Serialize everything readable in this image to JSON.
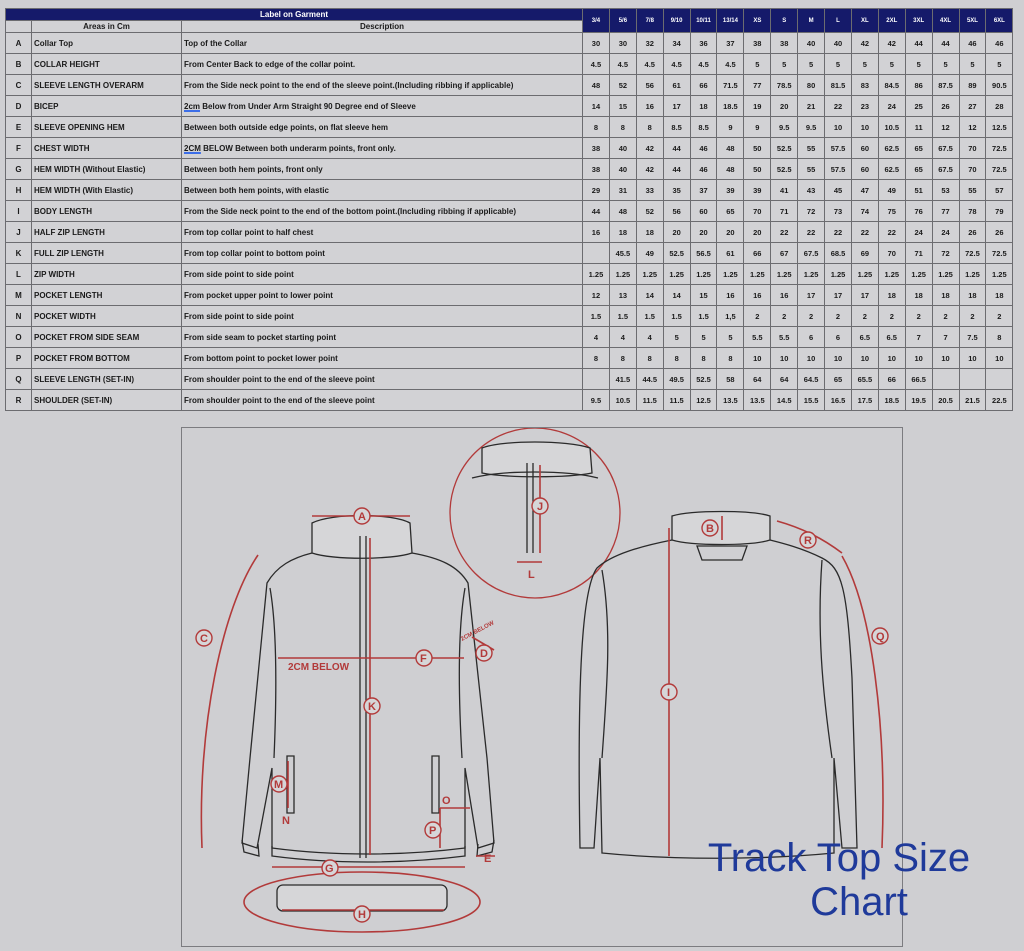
{
  "table": {
    "label_header": "Label on Garment",
    "areas_header": "Areas in Cm",
    "description_header": "Description",
    "sizes": [
      "3/4",
      "5/6",
      "7/8",
      "9/10",
      "10/11",
      "13/14",
      "XS",
      "S",
      "M",
      "L",
      "XL",
      "2XL",
      "3XL",
      "4XL",
      "5XL",
      "6XL"
    ],
    "rows": [
      {
        "letter": "A",
        "area": "Collar Top",
        "desc": "Top of the Collar",
        "values": [
          "30",
          "30",
          "32",
          "34",
          "36",
          "37",
          "38",
          "38",
          "40",
          "40",
          "42",
          "42",
          "44",
          "44",
          "46",
          "46"
        ]
      },
      {
        "letter": "B",
        "area": "COLLAR HEIGHT",
        "desc": "From Center Back to edge of the collar point.",
        "values": [
          "4.5",
          "4.5",
          "4.5",
          "4.5",
          "4.5",
          "4.5",
          "5",
          "5",
          "5",
          "5",
          "5",
          "5",
          "5",
          "5",
          "5",
          "5"
        ]
      },
      {
        "letter": "C",
        "area": "SLEEVE LENGTH OVERARM",
        "desc": "From the Side neck point to the end of the sleeve point.(Including ribbing if applicable)",
        "values": [
          "48",
          "52",
          "56",
          "61",
          "66",
          "71.5",
          "77",
          "78.5",
          "80",
          "81.5",
          "83",
          "84.5",
          "86",
          "87.5",
          "89",
          "90.5"
        ]
      },
      {
        "letter": "D",
        "area": "BICEP",
        "desc_u": "2cm",
        "desc": " Below from Under Arm Straight 90 Degree end of Sleeve",
        "values": [
          "14",
          "15",
          "16",
          "17",
          "18",
          "18.5",
          "19",
          "20",
          "21",
          "22",
          "23",
          "24",
          "25",
          "26",
          "27",
          "28"
        ]
      },
      {
        "letter": "E",
        "area": "SLEEVE OPENING HEM",
        "desc": "Between both outside edge points, on flat sleeve hem",
        "values": [
          "8",
          "8",
          "8",
          "8.5",
          "8.5",
          "9",
          "9",
          "9.5",
          "9.5",
          "10",
          "10",
          "10.5",
          "11",
          "12",
          "12",
          "12.5"
        ]
      },
      {
        "letter": "F",
        "area": "CHEST WIDTH",
        "desc_u": "2CM",
        "desc": " BELOW Between both underarm points, front only.",
        "values": [
          "38",
          "40",
          "42",
          "44",
          "46",
          "48",
          "50",
          "52.5",
          "55",
          "57.5",
          "60",
          "62.5",
          "65",
          "67.5",
          "70",
          "72.5"
        ]
      },
      {
        "letter": "G",
        "area": "HEM WIDTH (Without Elastic)",
        "desc": "Between both hem points, front only",
        "values": [
          "38",
          "40",
          "42",
          "44",
          "46",
          "48",
          "50",
          "52.5",
          "55",
          "57.5",
          "60",
          "62.5",
          "65",
          "67.5",
          "70",
          "72.5"
        ]
      },
      {
        "letter": "H",
        "area": "HEM WIDTH (With Elastic)",
        "desc": "Between both hem points, with elastic",
        "big": true,
        "values": [
          "29",
          "31",
          "33",
          "35",
          "37",
          "39",
          "39",
          "41",
          "43",
          "45",
          "47",
          "49",
          "51",
          "53",
          "55",
          "57"
        ]
      },
      {
        "letter": "I",
        "area": "BODY LENGTH",
        "desc": "From the Side neck point to the end of the bottom point.(Including ribbing if applicable)",
        "values": [
          "44",
          "48",
          "52",
          "56",
          "60",
          "65",
          "70",
          "71",
          "72",
          "73",
          "74",
          "75",
          "76",
          "77",
          "78",
          "79"
        ]
      },
      {
        "letter": "J",
        "area": "HALF ZIP LENGTH",
        "desc": "From top collar point to half chest",
        "values": [
          "16",
          "18",
          "18",
          "20",
          "20",
          "20",
          "20",
          "22",
          "22",
          "22",
          "22",
          "22",
          "24",
          "24",
          "26",
          "26"
        ]
      },
      {
        "letter": "K",
        "area": "FULL ZIP LENGTH",
        "desc": "From top collar point to bottom point",
        "values": [
          "",
          "45.5",
          "49",
          "52.5",
          "56.5",
          "61",
          "66",
          "67",
          "67.5",
          "68.5",
          "69",
          "70",
          "71",
          "72",
          "72.5",
          "72.5"
        ]
      },
      {
        "letter": "L",
        "area": "ZIP WIDTH",
        "desc": "From side point to side point",
        "values": [
          "1.25",
          "1.25",
          "1.25",
          "1.25",
          "1.25",
          "1.25",
          "1.25",
          "1.25",
          "1.25",
          "1.25",
          "1.25",
          "1.25",
          "1.25",
          "1.25",
          "1.25",
          "1.25"
        ]
      },
      {
        "letter": "M",
        "area": "POCKET LENGTH",
        "desc": "From pocket upper point to lower point",
        "values": [
          "12",
          "13",
          "14",
          "14",
          "15",
          "16",
          "16",
          "16",
          "17",
          "17",
          "17",
          "18",
          "18",
          "18",
          "18",
          "18"
        ]
      },
      {
        "letter": "N",
        "area": "POCKET WIDTH",
        "desc": "From side point to side point",
        "values": [
          "1.5",
          "1.5",
          "1.5",
          "1.5",
          "1.5",
          "1,5",
          "2",
          "2",
          "2",
          "2",
          "2",
          "2",
          "2",
          "2",
          "2",
          "2"
        ]
      },
      {
        "letter": "O",
        "area": "POCKET FROM SIDE SEAM",
        "desc": "From side seam to pocket starting point",
        "values": [
          "4",
          "4",
          "4",
          "5",
          "5",
          "5",
          "5.5",
          "5.5",
          "6",
          "6",
          "6.5",
          "6.5",
          "7",
          "7",
          "7.5",
          "8"
        ]
      },
      {
        "letter": "P",
        "area": "POCKET FROM BOTTOM",
        "desc": "From bottom point to pocket lower point",
        "values": [
          "8",
          "8",
          "8",
          "8",
          "8",
          "8",
          "10",
          "10",
          "10",
          "10",
          "10",
          "10",
          "10",
          "10",
          "10",
          "10"
        ]
      },
      {
        "letter": "Q",
        "area": "SLEEVE LENGTH (SET-IN)",
        "desc": "From shoulder point to the end of the sleeve point",
        "values": [
          "",
          "41.5",
          "44.5",
          "49.5",
          "52.5",
          "58",
          "64",
          "64",
          "64.5",
          "65",
          "65.5",
          "66",
          "66.5",
          "",
          "",
          ""
        ]
      },
      {
        "letter": "R",
        "area": "SHOULDER (SET-IN)",
        "desc": "From shoulder point to the end of the sleeve point",
        "values": [
          "9.5",
          "10.5",
          "11.5",
          "11.5",
          "12.5",
          "13.5",
          "13.5",
          "14.5",
          "15.5",
          "16.5",
          "17.5",
          "18.5",
          "19.5",
          "20.5",
          "21.5",
          "22.5"
        ]
      }
    ]
  },
  "diagram": {
    "markers": [
      "A",
      "B",
      "C",
      "D",
      "E",
      "F",
      "G",
      "H",
      "I",
      "J",
      "K",
      "L",
      "M",
      "N",
      "O",
      "P",
      "Q",
      "R"
    ],
    "note_2cm_below": "2CM BELOW",
    "note_2cm_below_small": "2CM BELOW"
  },
  "title": {
    "line1": "Track Top Size",
    "line2": "Chart",
    "color": "#1f3a9a"
  }
}
